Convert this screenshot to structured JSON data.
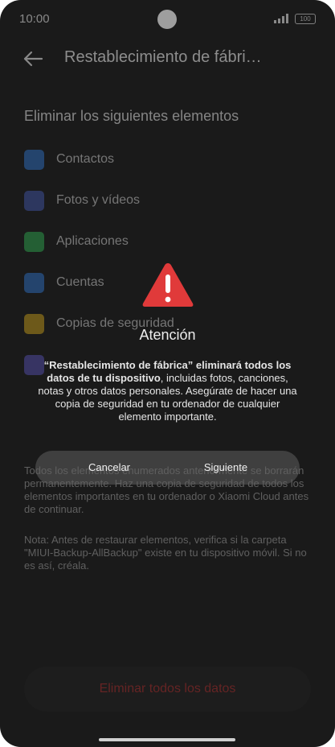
{
  "status_bar": {
    "time": "10:00",
    "battery": "100"
  },
  "header": {
    "title": "Restablecimiento de fábri…"
  },
  "section_title": "Eliminar los siguientes elementos",
  "items": [
    {
      "label": "Contactos",
      "icon": "contacts-icon",
      "color": "#3a6fb0"
    },
    {
      "label": "Fotos y vídeos",
      "icon": "gallery-icon",
      "color": "#4a5a9a"
    },
    {
      "label": "Aplicaciones",
      "icon": "apps-icon",
      "color": "#3a9a55"
    },
    {
      "label": "Cuentas",
      "icon": "accounts-icon",
      "color": "#3a6fb0"
    },
    {
      "label": "Copias de seguridad",
      "icon": "backup-icon",
      "color": "#b0902a"
    },
    {
      "label": "",
      "icon": "document-icon",
      "color": "#5a55a0"
    }
  ],
  "paragraph1": "Todos los elementos enumerados anteriormente se borrarán permanentemente. Haz una copia de seguridad de todos los elementos importantes en tu ordenador o Xiaomi Cloud antes de continuar.",
  "paragraph2": "Nota: Antes de restaurar elementos, verifica si la carpeta \"MIUI-Backup-AllBackup\" existe en tu dispositivo móvil. Si no es así, créala.",
  "bottom_button": "Eliminar todos los datos",
  "dialog": {
    "title": "Atención",
    "message_bold": "“Restablecimiento de fábrica” eliminará todos los datos de tu dispositivo",
    "message_rest": ", incluidas fotos, canciones, notas y otros datos personales. Asegúrate de hacer una copia de seguridad en tu ordenador de cualquier elemento importante.",
    "cancel": "Cancelar",
    "next": "Siguiente"
  },
  "colors": {
    "warning": "#e03a3a",
    "danger_text": "#a33a3a"
  }
}
